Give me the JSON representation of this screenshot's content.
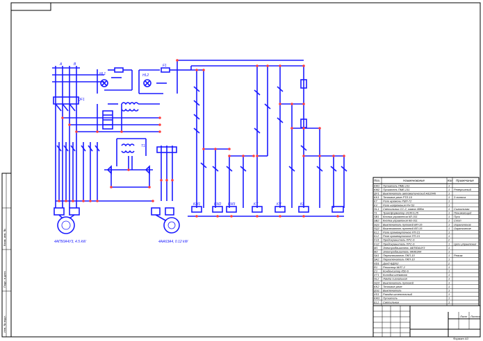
{
  "labels": {
    "bus_phases": [
      "A",
      "B",
      "C",
      "N"
    ],
    "qf1": "QF1",
    "fuse1": "F1",
    "motor_left": "4АП50А4У3, 4.5 kW",
    "motor_right": "4АА63А4, 0.12 kW",
    "lamp_hl1": "HL1",
    "lamp_hl2": "HL2",
    "transformer": "T1",
    "relays": [
      "KM1",
      "KM2",
      "KM3",
      "KT",
      "KV",
      "KL"
    ]
  },
  "table": {
    "col_pos": "Поз.",
    "col_name": "Наименование",
    "col_qty": "Кол",
    "col_note": "Примечание",
    "rows": [
      {
        "pos": "KM1",
        "name": "Пускатель ПМЕ-211",
        "qty": "1",
        "note": ""
      },
      {
        "pos": "KM2",
        "name": "Пускатель ПМЕ-211",
        "qty": "1",
        "note": "Реверсивный"
      },
      {
        "pos": "QF1",
        "name": "Выключатель автоматический АЕ2046",
        "qty": "1",
        "note": ""
      },
      {
        "pos": "KK1",
        "name": "Тепловое реле РТЛ-10",
        "qty": "1",
        "note": "3 полюса"
      },
      {
        "pos": "KT",
        "name": "Реле времени РВП-72",
        "qty": "1",
        "note": ""
      },
      {
        "pos": "KV",
        "name": "Реле напряжения РН-53",
        "qty": "1",
        "note": ""
      },
      {
        "pos": "HL1",
        "name": "Светильник СС-2, лампа 40Вт",
        "qty": "1",
        "note": "Сигнальная"
      },
      {
        "pos": "T1",
        "name": "Трансформатор ОСМ-0,25",
        "qty": "1",
        "note": "Понижающий"
      },
      {
        "pos": "SB1",
        "name": "Кнопка управления КЕ-011",
        "qty": "1",
        "note": "Пуск"
      },
      {
        "pos": "SB2",
        "name": "Кнопка управления КЕ-011",
        "qty": "1",
        "note": "Стоп"
      },
      {
        "pos": "SQ1",
        "name": "Выключатель путевой ВП-15",
        "qty": "1",
        "note": "Ограничение"
      },
      {
        "pos": "SQ2",
        "name": "Выключатель путевой ВП-15",
        "qty": "1",
        "note": "Ограничение"
      },
      {
        "pos": "KL1",
        "name": "Реле промежуточное РП-21",
        "qty": "1",
        "note": ""
      },
      {
        "pos": "KL2",
        "name": "Реле промежуточное РП-21",
        "qty": "1",
        "note": ""
      },
      {
        "pos": "FU1",
        "name": "Предохранитель ПРС-6",
        "qty": "2",
        "note": ""
      },
      {
        "pos": "FU2",
        "name": "Предохранитель ПРС-6",
        "qty": "1",
        "note": "Цепи управления"
      },
      {
        "pos": "M1",
        "name": "Электродвигатель 4АП50А4У3",
        "qty": "1",
        "note": ""
      },
      {
        "pos": "M2",
        "name": "Электродвигатель 4АА63А4",
        "qty": "1",
        "note": ""
      },
      {
        "pos": "SA1",
        "name": "Переключатель ПКП-10",
        "qty": "1",
        "note": "Режим"
      },
      {
        "pos": "SA2",
        "name": "Переключатель ПКП-10",
        "qty": "1",
        "note": ""
      },
      {
        "pos": "VD1",
        "name": "Диод КД202",
        "qty": "2",
        "note": ""
      },
      {
        "pos": "R1",
        "name": "Резистор МЛТ-2",
        "qty": "1",
        "note": ""
      },
      {
        "pos": "C1",
        "name": "Конденсатор К50-6",
        "qty": "1",
        "note": ""
      },
      {
        "pos": "XT1",
        "name": "Колодка клеммная",
        "qty": "1",
        "note": ""
      },
      {
        "pos": "HL2",
        "name": "Лампа сигнальная",
        "qty": "1",
        "note": ""
      },
      {
        "pos": "SQ3",
        "name": "Выключатель путевой",
        "qty": "1",
        "note": ""
      },
      {
        "pos": "KK2",
        "name": "Тепловое реле",
        "qty": "1",
        "note": ""
      },
      {
        "pos": "QS1",
        "name": "Выключатель",
        "qty": "1",
        "note": ""
      },
      {
        "pos": "XS1",
        "name": "Разъём штепсельный",
        "qty": "1",
        "note": ""
      },
      {
        "pos": "KM3",
        "name": "Пускатель",
        "qty": "1",
        "note": ""
      },
      {
        "pos": "EL1",
        "name": "Светильник",
        "qty": "1",
        "note": ""
      }
    ]
  },
  "stamp": {
    "sheet_label": "Лист",
    "sheets_label": "Листов",
    "format": "Формат А3"
  },
  "side_strip": {
    "inv_no": "Инв. № подл.",
    "sign_date": "Подп. и дата",
    "inv_dup": "Взам. инв. №"
  }
}
